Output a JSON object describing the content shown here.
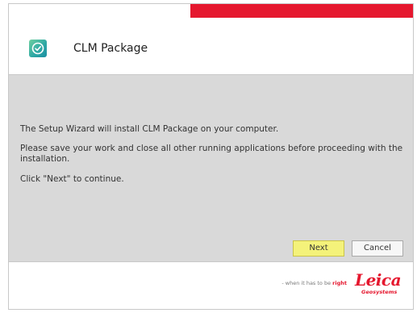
{
  "window": {
    "title": "CLM Package",
    "icon": "check-circle-icon",
    "accent_color": "#e5172e"
  },
  "content": {
    "line1": "The Setup Wizard will install CLM Package on your computer.",
    "line2": "Please save your work and close all other running applications before proceeding with the installation.",
    "line3": "Click \"Next\" to continue."
  },
  "buttons": {
    "next_label": "Next",
    "cancel_label": "Cancel"
  },
  "footer": {
    "tagline_prefix": "- when it has to be ",
    "tagline_emph": "right",
    "logo_word": "Leica",
    "logo_sub": "Geosystems"
  }
}
